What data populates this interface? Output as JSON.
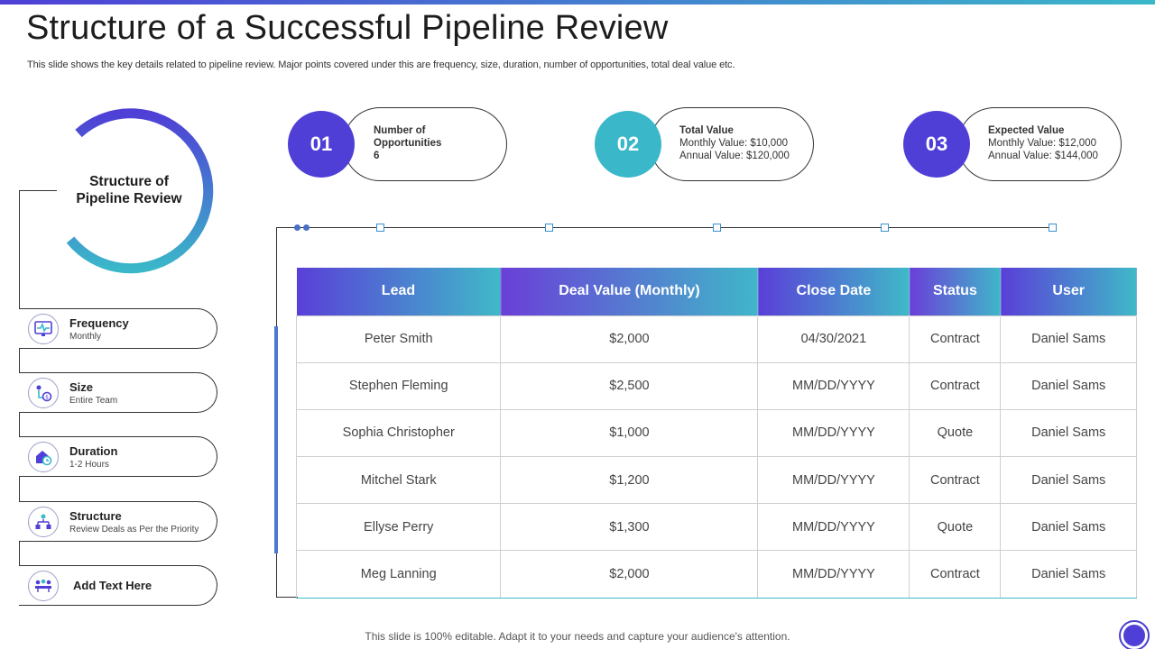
{
  "title": "Structure of a Successful Pipeline Review",
  "subtitle": "This slide shows the key details related to pipeline review. Major points covered under this are frequency, size, duration, number of opportunities, total deal value etc.",
  "ring_label": "Structure of Pipeline Review",
  "left_items": [
    {
      "title": "Frequency",
      "sub": "Monthly",
      "icon": "monitor-pulse-icon"
    },
    {
      "title": "Size",
      "sub": "Entire Team",
      "icon": "money-flow-icon"
    },
    {
      "title": "Duration",
      "sub": "1-2 Hours",
      "icon": "house-clock-icon"
    },
    {
      "title": "Structure",
      "sub": "Review Deals as Per the Priority",
      "icon": "org-chart-icon"
    },
    {
      "title": "Add Text Here",
      "sub": "",
      "icon": "team-icon"
    }
  ],
  "cards": [
    {
      "number": "01",
      "heading": "Number of",
      "line2": "Opportunities",
      "line3": "6",
      "color": "#4f3fd6"
    },
    {
      "number": "02",
      "heading": "Total Value",
      "line2": "Monthly Value: $10,000",
      "line3": "Annual Value: $120,000",
      "color": "#3ab7c9"
    },
    {
      "number": "03",
      "heading": "Expected Value",
      "line2": "Monthly Value: $12,000",
      "line3": "Annual Value: $144,000",
      "color": "#4f3fd6"
    }
  ],
  "table": {
    "headers": [
      "Lead",
      "Deal Value (Monthly)",
      "Close Date",
      "Status",
      "User"
    ],
    "rows": [
      [
        "Peter Smith",
        "$2,000",
        "04/30/2021",
        "Contract",
        "Daniel Sams"
      ],
      [
        "Stephen Fleming",
        "$2,500",
        "MM/DD/YYYY",
        "Contract",
        "Daniel Sams"
      ],
      [
        "Sophia Christopher",
        "$1,000",
        "MM/DD/YYYY",
        "Quote",
        "Daniel Sams"
      ],
      [
        "Mitchel Stark",
        "$1,200",
        "MM/DD/YYYY",
        "Contract",
        "Daniel Sams"
      ],
      [
        "Ellyse Perry",
        "$1,300",
        "MM/DD/YYYY",
        "Quote",
        "Daniel Sams"
      ],
      [
        "Meg Lanning",
        "$2,000",
        "MM/DD/YYYY",
        "Contract",
        "Daniel Sams"
      ]
    ]
  },
  "footer": "This slide is 100% editable. Adapt it to your needs and capture your audience's attention."
}
